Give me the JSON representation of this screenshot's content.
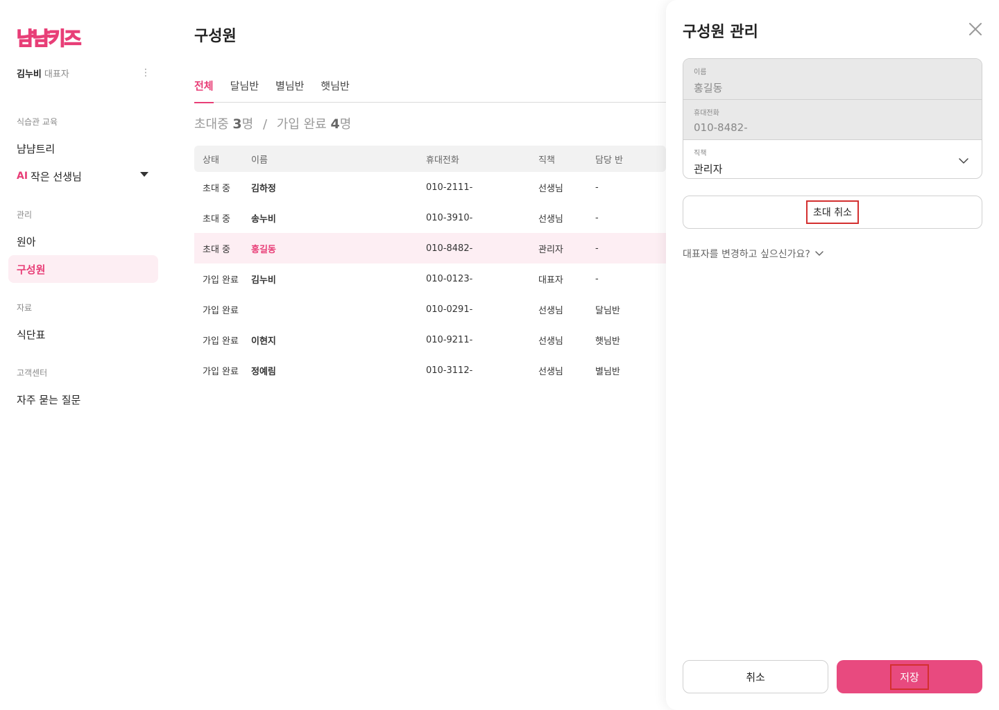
{
  "app": {
    "logo_text": "냠냠키즈"
  },
  "user": {
    "name": "김누비",
    "role": "대표자"
  },
  "sidebar": {
    "sections": [
      {
        "label": "식습관 교육"
      },
      {
        "label": "관리"
      },
      {
        "label": "자료"
      },
      {
        "label": "고객센터"
      }
    ],
    "items": [
      {
        "label": "냠냠트리"
      },
      {
        "badge": "AI",
        "label": "작은 선생님"
      },
      {
        "label": "원아"
      },
      {
        "label": "구성원"
      },
      {
        "label": "식단표"
      },
      {
        "label": "자주 묻는 질문"
      }
    ],
    "active": "구성원"
  },
  "main": {
    "title": "구성원",
    "tabs": [
      {
        "label": "전체",
        "active": true
      },
      {
        "label": "달님반"
      },
      {
        "label": "별님반"
      },
      {
        "label": "햇님반"
      }
    ],
    "summary": {
      "invited_label": "초대중",
      "invited_count": "3",
      "invited_unit": "명",
      "separator": "/",
      "joined_label": "가입 완료",
      "joined_count": "4",
      "joined_unit": "명"
    },
    "table": {
      "headers": [
        "상태",
        "이름",
        "휴대전화",
        "직책",
        "담당 반"
      ],
      "rows": [
        {
          "status": "초대 중",
          "name": "김하정",
          "phone": "010-2111-",
          "role": "선생님",
          "class": "-"
        },
        {
          "status": "초대 중",
          "name": "송누비",
          "phone": "010-3910-",
          "role": "선생님",
          "class": "-"
        },
        {
          "status": "초대 중",
          "name": "홍길동",
          "phone": "010-8482-",
          "role": "관리자",
          "class": "-"
        },
        {
          "status": "가입 완료",
          "name": "김누비",
          "phone": "010-0123-",
          "role": "대표자",
          "class": "-"
        },
        {
          "status": "가입 완료",
          "name": "",
          "phone": "010-0291-",
          "role": "선생님",
          "class": "달님반"
        },
        {
          "status": "가입 완료",
          "name": "이현지",
          "phone": "010-9211-",
          "role": "선생님",
          "class": "햇님반"
        },
        {
          "status": "가입 완료",
          "name": "정예림",
          "phone": "010-3112-",
          "role": "선생님",
          "class": "별님반"
        }
      ]
    }
  },
  "panel": {
    "title": "구성원 관리",
    "fields": {
      "name": {
        "label": "이름",
        "value": "홍길동"
      },
      "phone": {
        "label": "휴대전화",
        "value": "010-8482-"
      },
      "role": {
        "label": "직책",
        "value": "관리자"
      }
    },
    "cancel_invite_label": "초대 취소",
    "change_owner_label": "대표자를 변경하고 싶으신가요?",
    "cancel_label": "취소",
    "save_label": "저장"
  },
  "colors": {
    "accent": "#e83e77",
    "save_button": "#e84a7f",
    "highlight_row": "#fdeef3",
    "annotation_box": "#d32f2f"
  },
  "icons": [
    "kebab-icon",
    "caret-down-icon",
    "close-icon",
    "chevron-down-icon"
  ]
}
